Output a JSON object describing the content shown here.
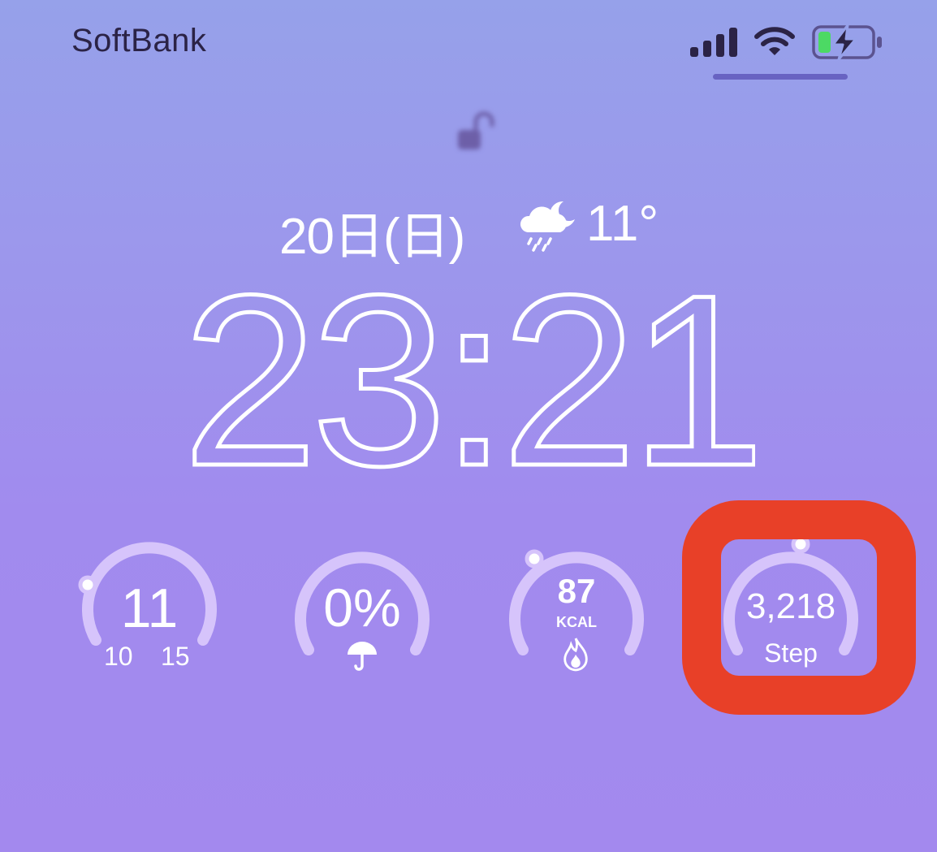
{
  "status_bar": {
    "carrier": "SoftBank",
    "signal_icon": "cellular-signal-icon",
    "wifi_icon": "wifi-icon",
    "battery_icon": "battery-charging-icon",
    "battery_fill_color": "#4cd964"
  },
  "lock_screen": {
    "lock_icon": "lock-open-icon",
    "date": "20日(日)",
    "weather_icon": "rain-night-cloud-icon",
    "temperature": "11°",
    "time": "23:21"
  },
  "widgets": {
    "temperature": {
      "value": "11",
      "low": "10",
      "high": "15",
      "progress": 0.15
    },
    "rain": {
      "value": "0%",
      "icon": "umbrella-icon",
      "progress": 0.0
    },
    "calories": {
      "value": "87",
      "unit": "KCAL",
      "icon": "flame-icon",
      "progress": 0.1
    },
    "steps": {
      "value": "3,218",
      "label": "Step",
      "progress": 0.5
    }
  },
  "colors": {
    "ring_track": "#d6c4fb",
    "highlight": "#e84028",
    "text": "#ffffff"
  }
}
